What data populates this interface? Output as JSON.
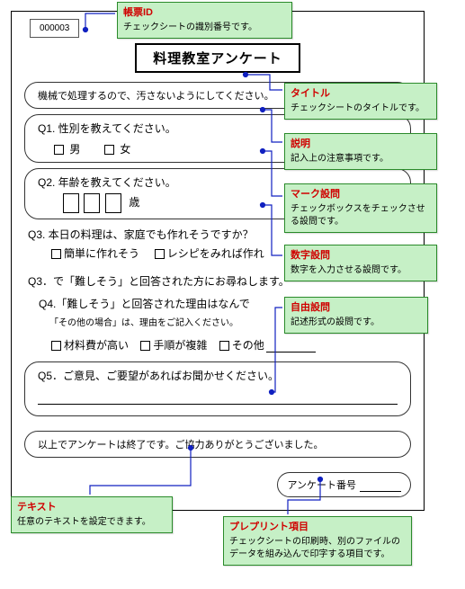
{
  "form_id": "000003",
  "title": "料理教室アンケート",
  "instruction": "機械で処理するので、汚さないようにしてください。",
  "q1": {
    "label": "Q1. 性別を教えてください。",
    "opt1": "男",
    "opt2": "女"
  },
  "q2": {
    "label": "Q2. 年齢を教えてください。",
    "unit": "歳"
  },
  "q3": {
    "label": "Q3. 本日の料理は、家庭でも作れそうですか？",
    "opt1": "簡単に作れそう",
    "opt2": "レシピをみれば作れ",
    "followup": "Q3．で「難しそう」と回答された方にお尋ねします。"
  },
  "q4": {
    "label": "Q4.「難しそう」と回答された理由はなんで",
    "sub": "「その他の場合」は、理由をご記入ください。",
    "opt1": "材料費が高い",
    "opt2": "手順が複雑",
    "opt3": "その他"
  },
  "q5": {
    "label": "Q5．ご意見、ご要望があればお聞かせください。"
  },
  "closing": "以上でアンケートは終了です。ご協力ありがとうございました。",
  "survey_num_label": "アンケート番号",
  "callouts": {
    "formid": {
      "title": "帳票ID",
      "desc": "チェックシートの識別番号です。"
    },
    "title": {
      "title": "タイトル",
      "desc": "チェックシートのタイトルです。"
    },
    "inst": {
      "title": "説明",
      "desc": "記入上の注意事項です。"
    },
    "mark": {
      "title": "マーク設問",
      "desc": "チェックボックスをチェックさせる設問です。"
    },
    "num": {
      "title": "数字設問",
      "desc": "数字を入力させる設問です。"
    },
    "free": {
      "title": "自由設問",
      "desc": "記述形式の設問です。"
    },
    "text": {
      "title": "テキスト",
      "desc": "任意のテキストを設定できます。"
    },
    "preprint": {
      "title": "プレプリント項目",
      "desc": "チェックシートの印刷時、別のファイルのデータを組み込んで印字する項目です。"
    }
  }
}
